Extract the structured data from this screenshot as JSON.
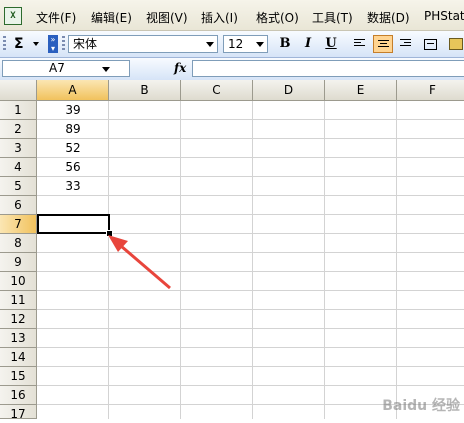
{
  "menu": {
    "items": [
      "文件(F)",
      "编辑(E)",
      "视图(V)",
      "插入(I)",
      "格式(O)",
      "工具(T)",
      "数据(D)",
      "PHStat"
    ]
  },
  "toolbar": {
    "sigma": "Σ",
    "font": "宋体",
    "size": "12",
    "bold": "B",
    "italic": "I",
    "underline": "U"
  },
  "formula_bar": {
    "name_box": "A7",
    "fx": "fx",
    "formula": ""
  },
  "sheet": {
    "columns": [
      "A",
      "B",
      "C",
      "D",
      "E",
      "F"
    ],
    "rows": [
      "1",
      "2",
      "3",
      "4",
      "5",
      "6",
      "7",
      "8",
      "9",
      "10",
      "11",
      "12",
      "13",
      "14",
      "15",
      "16",
      "17"
    ],
    "column_a_values": [
      "39",
      "89",
      "52",
      "56",
      "33"
    ],
    "selected_cell": "A7",
    "arrow_color": "#e8453c"
  },
  "watermark": "Baidu 经验"
}
